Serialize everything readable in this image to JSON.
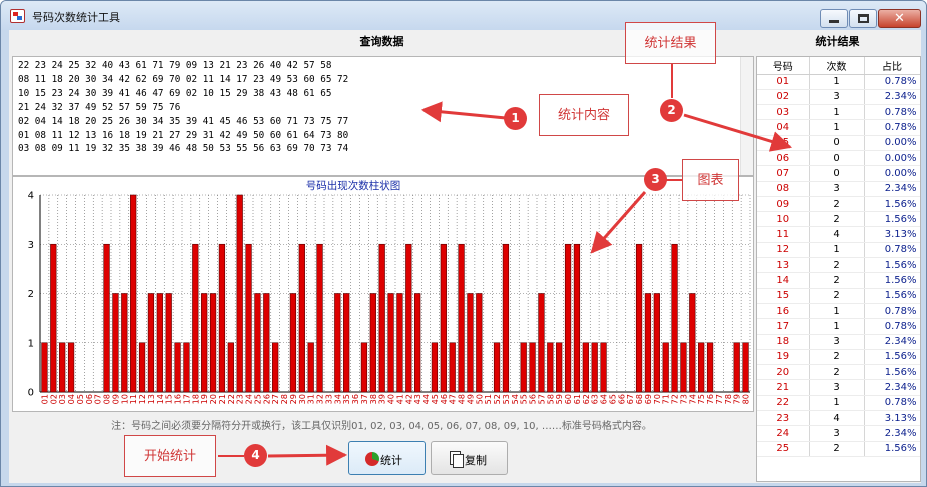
{
  "window": {
    "title": "号码次数统计工具"
  },
  "headers": {
    "query": "查询数据",
    "result": "统计结果"
  },
  "query_text": "22 23 24 25 32 40 43 61 71 79 09 13 21 23 26 40 42 57 58\n08 11 18 20 30 34 42 62 69 70 02 11 14 17 23 49 53 60 65 72\n10 15 23 24 30 39 41 46 47 69 02 10 15 29 38 43 48 61 65\n21 24 32 37 49 52 57 59 75 76\n02 04 14 18 20 25 26 30 34 35 39 41 45 46 53 60 71 73 75 77\n01 08 11 12 13 16 18 19 21 27 29 31 42 49 50 60 61 64 73 80\n03 08 09 11 19 32 35 38 39 46 48 50 53 55 56 63 69 70 73 74",
  "chart_data": {
    "type": "bar",
    "title": "号码出现次数柱状图",
    "categories": [
      "01",
      "02",
      "03",
      "04",
      "05",
      "06",
      "07",
      "08",
      "09",
      "10",
      "11",
      "12",
      "13",
      "14",
      "15",
      "16",
      "17",
      "18",
      "19",
      "20",
      "21",
      "22",
      "23",
      "24",
      "25",
      "26",
      "27",
      "28",
      "29",
      "30",
      "31",
      "32",
      "33",
      "34",
      "35",
      "36",
      "37",
      "38",
      "39",
      "40",
      "41",
      "42",
      "43",
      "44",
      "45",
      "46",
      "47",
      "48",
      "49",
      "50",
      "51",
      "52",
      "53",
      "54",
      "55",
      "56",
      "57",
      "58",
      "59",
      "60",
      "61",
      "62",
      "63",
      "64",
      "65",
      "66",
      "67",
      "68",
      "69",
      "70",
      "71",
      "72",
      "73",
      "74",
      "75",
      "76",
      "77",
      "78",
      "79",
      "80"
    ],
    "values": [
      1,
      3,
      1,
      1,
      0,
      0,
      0,
      3,
      2,
      2,
      4,
      1,
      2,
      2,
      2,
      1,
      1,
      3,
      2,
      2,
      3,
      1,
      4,
      3,
      2,
      2,
      1,
      0,
      2,
      3,
      1,
      3,
      0,
      2,
      2,
      0,
      1,
      2,
      3,
      2,
      2,
      3,
      2,
      0,
      1,
      3,
      1,
      3,
      2,
      2,
      0,
      1,
      3,
      0,
      1,
      1,
      2,
      1,
      1,
      3,
      3,
      1,
      1,
      1,
      0,
      0,
      0,
      3,
      2,
      2,
      1,
      3,
      1,
      2,
      1,
      1,
      0,
      0,
      1,
      1
    ],
    "ylim": [
      0,
      4
    ],
    "yticks": [
      0,
      1,
      2,
      3,
      4
    ],
    "bar_color": "#dd0000"
  },
  "note": "注：号码之间必须要分隔符分开或换行，该工具仅识别01, 02, 03, 04, 05, 06, 07, 08, 09, 10, ……标准号码格式内容。",
  "buttons": {
    "stat": "统计",
    "copy": "复制"
  },
  "grid": {
    "columns": [
      "号码",
      "次数",
      "占比"
    ],
    "rows": [
      [
        "01",
        "1",
        "0.78%"
      ],
      [
        "02",
        "3",
        "2.34%"
      ],
      [
        "03",
        "1",
        "0.78%"
      ],
      [
        "04",
        "1",
        "0.78%"
      ],
      [
        "05",
        "0",
        "0.00%"
      ],
      [
        "06",
        "0",
        "0.00%"
      ],
      [
        "07",
        "0",
        "0.00%"
      ],
      [
        "08",
        "3",
        "2.34%"
      ],
      [
        "09",
        "2",
        "1.56%"
      ],
      [
        "10",
        "2",
        "1.56%"
      ],
      [
        "11",
        "4",
        "3.13%"
      ],
      [
        "12",
        "1",
        "0.78%"
      ],
      [
        "13",
        "2",
        "1.56%"
      ],
      [
        "14",
        "2",
        "1.56%"
      ],
      [
        "15",
        "2",
        "1.56%"
      ],
      [
        "16",
        "1",
        "0.78%"
      ],
      [
        "17",
        "1",
        "0.78%"
      ],
      [
        "18",
        "3",
        "2.34%"
      ],
      [
        "19",
        "2",
        "1.56%"
      ],
      [
        "20",
        "2",
        "1.56%"
      ],
      [
        "21",
        "3",
        "2.34%"
      ],
      [
        "22",
        "1",
        "0.78%"
      ],
      [
        "23",
        "4",
        "3.13%"
      ],
      [
        "24",
        "3",
        "2.34%"
      ],
      [
        "25",
        "2",
        "1.56%"
      ]
    ]
  },
  "callouts": [
    {
      "num": "1",
      "label": "统计内容"
    },
    {
      "num": "2",
      "label": "统计结果"
    },
    {
      "num": "3",
      "label": "图表"
    },
    {
      "num": "4",
      "label": "开始统计"
    }
  ],
  "accent": {
    "callout": "#e13a3a",
    "stat_button_border": "#3c7fb1"
  }
}
